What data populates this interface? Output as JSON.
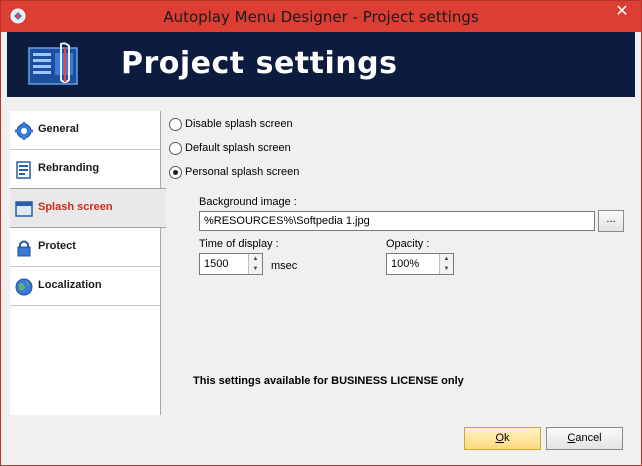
{
  "window": {
    "title": "Autoplay Menu Designer - Project settings",
    "close_glyph": "✕"
  },
  "header": {
    "title": "Project settings"
  },
  "sidebar": {
    "items": [
      {
        "label": "General",
        "icon": "gear-icon"
      },
      {
        "label": "Rebranding",
        "icon": "document-icon"
      },
      {
        "label": "Splash screen",
        "icon": "window-icon",
        "selected": true
      },
      {
        "label": "Protect",
        "icon": "lock-icon"
      },
      {
        "label": "Localization",
        "icon": "globe-icon"
      }
    ]
  },
  "splash": {
    "options": [
      {
        "label": "Disable splash screen",
        "checked": false
      },
      {
        "label": "Default splash screen",
        "checked": false
      },
      {
        "label": "Personal splash screen",
        "checked": true
      }
    ],
    "background_label": "Background image :",
    "background_value": "%RESOURCES%\\Softpedia 1.jpg",
    "browse_label": "...",
    "time_label": "Time of display :",
    "time_value": "1500",
    "time_unit": "msec",
    "opacity_label": "Opacity :",
    "opacity_value": "100%",
    "notice": "This settings available for BUSINESS LICENSE only"
  },
  "footer": {
    "ok_first": "O",
    "ok_rest": "k",
    "cancel_first": "C",
    "cancel_rest": "ancel"
  },
  "colors": {
    "title_bar": "#dc3e34",
    "header_band": "#0d1b3e",
    "selected_label": "#cc2b1e"
  }
}
